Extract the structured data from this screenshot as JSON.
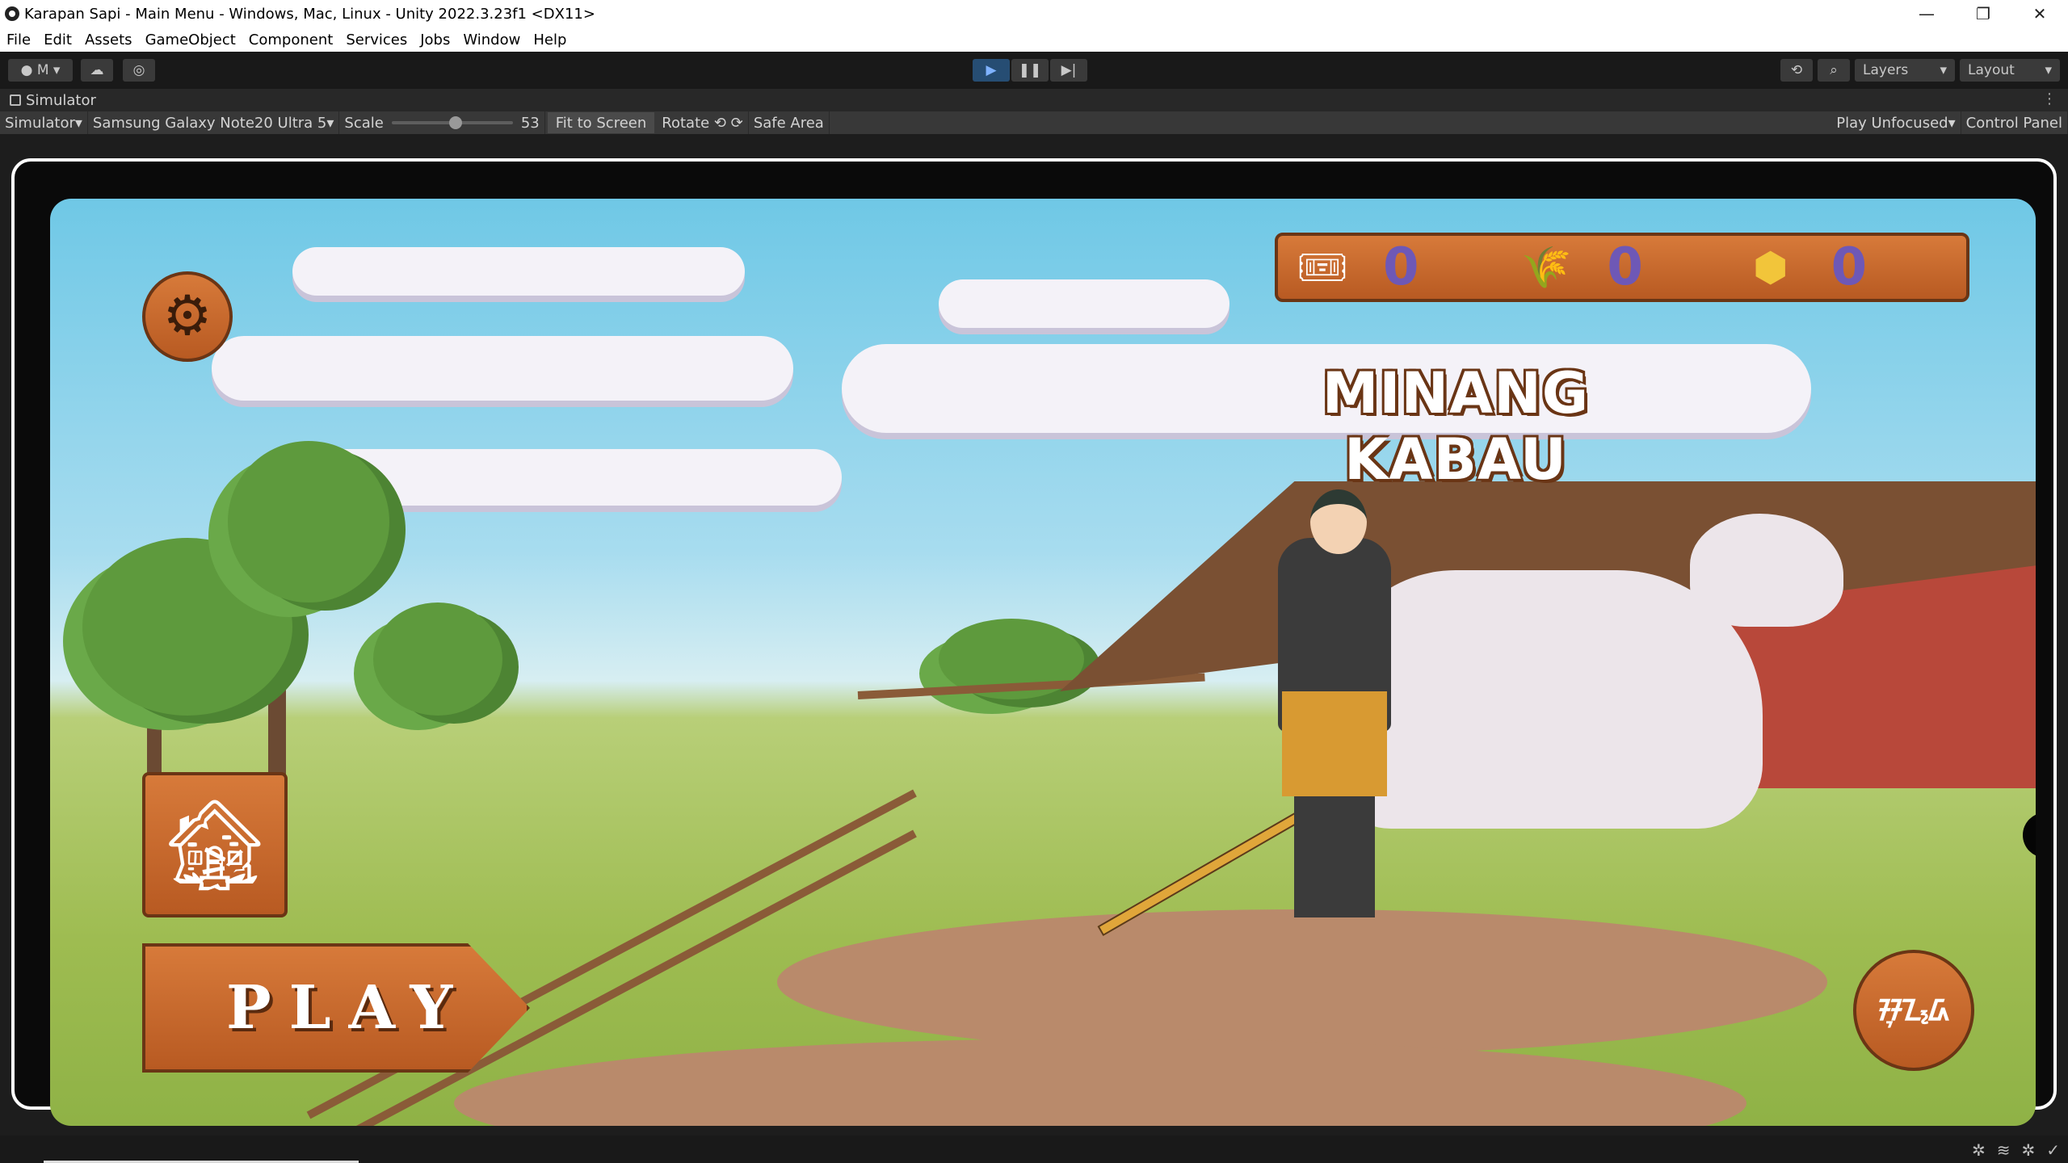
{
  "window": {
    "title": "Karapan Sapi - Main Menu - Windows, Mac, Linux - Unity 2022.3.23f1 <DX11>",
    "minimize": "—",
    "restore": "❐",
    "close": "✕"
  },
  "menu": [
    "File",
    "Edit",
    "Assets",
    "GameObject",
    "Component",
    "Services",
    "Jobs",
    "Window",
    "Help"
  ],
  "toolbar": {
    "account": "M",
    "play": "▶",
    "pause": "❚❚",
    "step": "▶|",
    "layers": "Layers",
    "layout": "Layout"
  },
  "simulator": {
    "tab": "Simulator",
    "mode": "Simulator",
    "device": "Samsung Galaxy Note20 Ultra 5",
    "scale_label": "Scale",
    "scale_value": "53",
    "fit": "Fit to Screen",
    "rotate": "Rotate",
    "safe_area": "Safe Area",
    "play_focus": "Play Unfocused",
    "control_panel": "Control Panel"
  },
  "game": {
    "title": "MINANG KABAU",
    "play_label": "PLAY",
    "lang_label": "ᮞᮥᮔ᮪ᮓ",
    "resources": [
      {
        "icon": "ticket-icon",
        "glyph": "🎟",
        "value": "0"
      },
      {
        "icon": "grass-icon",
        "glyph": "🌾",
        "value": "0"
      },
      {
        "icon": "coin-icon",
        "glyph": "⬢",
        "value": "0"
      }
    ]
  },
  "colors": {
    "wood": "#c96a2c",
    "value_text": "#6e58b6",
    "play_active": "#264d73"
  }
}
